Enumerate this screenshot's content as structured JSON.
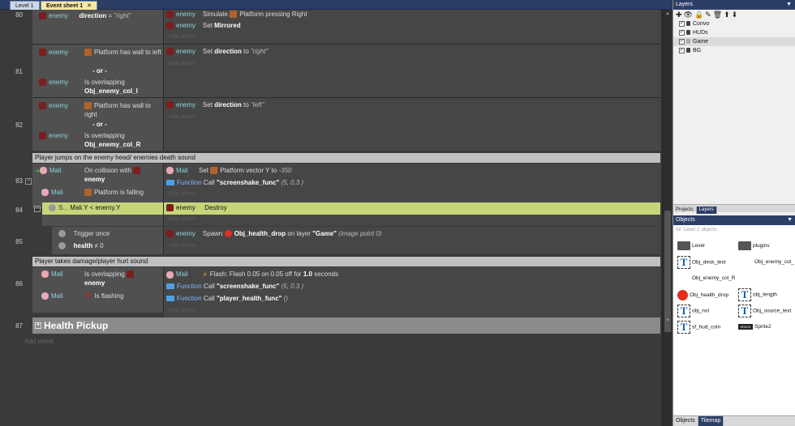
{
  "tabs": {
    "level": "Level 1",
    "sheet": "Event sheet 1",
    "close": "✕"
  },
  "lines": [
    "80",
    "81",
    "82",
    "83",
    "84",
    "85",
    "86",
    "87"
  ],
  "comments": {
    "c1": "Player jumps on the enemy head/ enemies death sound",
    "c2": "Player takes damage/player hurt sound"
  },
  "e80": {
    "c_obj": "enemy",
    "c_prop": "direction",
    "c_op": "=",
    "c_val": "\"right\"",
    "a1_obj": "enemy",
    "a1_txt": "Simulate",
    "a1_rest": "Platform pressing Right",
    "a2_obj": "enemy",
    "a2_txt": "Set",
    "a2_b": "Mirrored",
    "add": "Add action"
  },
  "e81": {
    "c1_obj": "enemy",
    "c1_txt": "Platform has wall to left",
    "or": "- or -",
    "c2_obj": "enemy",
    "c2_txt": "Is overlapping",
    "c2_b": "Obj_enemy_col_l",
    "a1_obj": "enemy",
    "a1_txt": "Set",
    "a1_b": "direction",
    "a1_to": "to",
    "a1_val": "\"right\"",
    "add": "Add action"
  },
  "e82": {
    "c1_obj": "enemy",
    "c1_txt": "Platform has wall to right",
    "or": "- or -",
    "c2_obj": "enemy",
    "c2_txt": "Is overlapping",
    "c2_b": "Obj_enemy_col_R",
    "a1_obj": "enemy",
    "a1_txt": "Set",
    "a1_b": "direction",
    "a1_to": "to",
    "a1_val": "\"left\"",
    "add": "Add action"
  },
  "e83": {
    "c1_obj": "Mali",
    "c1_txt": "On collision with",
    "c1_b": "enemy",
    "c2_obj": "Mali",
    "c2_txt": "Platform is falling",
    "a1_obj": "Mali",
    "a1_txt": "Set",
    "a1_rest": "Platform vector Y to",
    "a1_val": "-350",
    "a2_obj": "Function",
    "a2_txt": "Call",
    "a2_b": "\"screenshake_func\"",
    "a2_args": "(5, 0.3 )",
    "add": "Add action"
  },
  "e84": {
    "c_obj": "S...",
    "c_txt": "Mali.Y < enemy.Y",
    "a1_obj": "enemy",
    "a1_txt": "Destroy",
    "add": "Add action"
  },
  "e85": {
    "c1_txt": "Trigger once",
    "c2_b": "health",
    "c2_txt": "≠ 0",
    "a1_obj": "enemy",
    "a1_txt": "Spawn",
    "a1_b": "Obj_health_drop",
    "a1_on": "on layer",
    "a1_layer": "\"Game\"",
    "a1_pt": "(image point 0)",
    "add": "Add action"
  },
  "e86": {
    "c1_obj": "Mali",
    "c1_txt": "Is overlapping",
    "c1_b": "enemy",
    "c2_obj": "Mali",
    "c2_txt": "Is flashing",
    "a1_obj": "Mali",
    "a1_txt": "Flash: Flash 0.05 on 0.05 off for",
    "a1_b": "1.0",
    "a1_end": "seconds",
    "a2_obj": "Function",
    "a2_txt": "Call",
    "a2_b": "\"screenshake_func\"",
    "a2_args": "(5, 0.3 )",
    "a3_obj": "Function",
    "a3_txt": "Call",
    "a3_b": "\"player_health_func\"",
    "a3_args": "()",
    "add": "Add action"
  },
  "e87": {
    "toggle": "+",
    "title": "Health Pickup"
  },
  "add_event": "Add event",
  "layers_panel": {
    "title": "Layers",
    "tools": "✚👁🔒✎🗑⬆⬇",
    "items": [
      "Convo",
      "HUDs",
      "Game",
      "BG"
    ]
  },
  "panel_tabs": {
    "projects": "Projects",
    "layers": "Layers"
  },
  "objects_panel": {
    "title": "Objects",
    "filter": "All 'Level 1' objects",
    "items": [
      "Level",
      "plugins",
      "Obj_desk_text",
      "Obj_enemy_col_",
      "Obj_enemy_col_R",
      "Obj_health_drop",
      "obj_length",
      "obj_nol",
      "Obj_source_text",
      "sf_hud_coin",
      "Sprite2"
    ],
    "space_label": "SPACE"
  },
  "bottom_tabs": {
    "objects": "Objects",
    "tilemap": "Tilemap"
  }
}
